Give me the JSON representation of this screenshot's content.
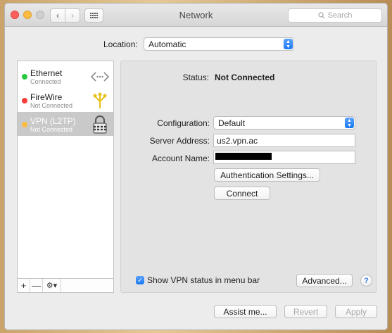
{
  "window": {
    "title": "Network",
    "search_placeholder": "Search"
  },
  "location": {
    "label": "Location:",
    "value": "Automatic"
  },
  "services": [
    {
      "name": "Ethernet",
      "status": "Connected",
      "status_color": "#28c940",
      "icon": "ethernet-arrows-icon"
    },
    {
      "name": "FireWire",
      "status": "Not Connected",
      "status_color": "#fc3d39",
      "icon": "firewire-icon"
    },
    {
      "name": "VPN (L2TP)",
      "status": "Not Connected",
      "status_color": "#fdbc40",
      "icon": "vpn-lock-icon"
    }
  ],
  "sidebar_tools": {
    "add": "+",
    "remove": "—"
  },
  "details": {
    "status_label": "Status:",
    "status_value": "Not Connected",
    "configuration_label": "Configuration:",
    "configuration_value": "Default",
    "server_label": "Server Address:",
    "server_value": "us2.vpn.ac",
    "account_label": "Account Name:",
    "auth_button": "Authentication Settings...",
    "connect_button": "Connect",
    "show_vpn_label": "Show VPN status in menu bar",
    "advanced_button": "Advanced...",
    "help": "?"
  },
  "footer": {
    "assist": "Assist me...",
    "revert": "Revert",
    "apply": "Apply"
  }
}
